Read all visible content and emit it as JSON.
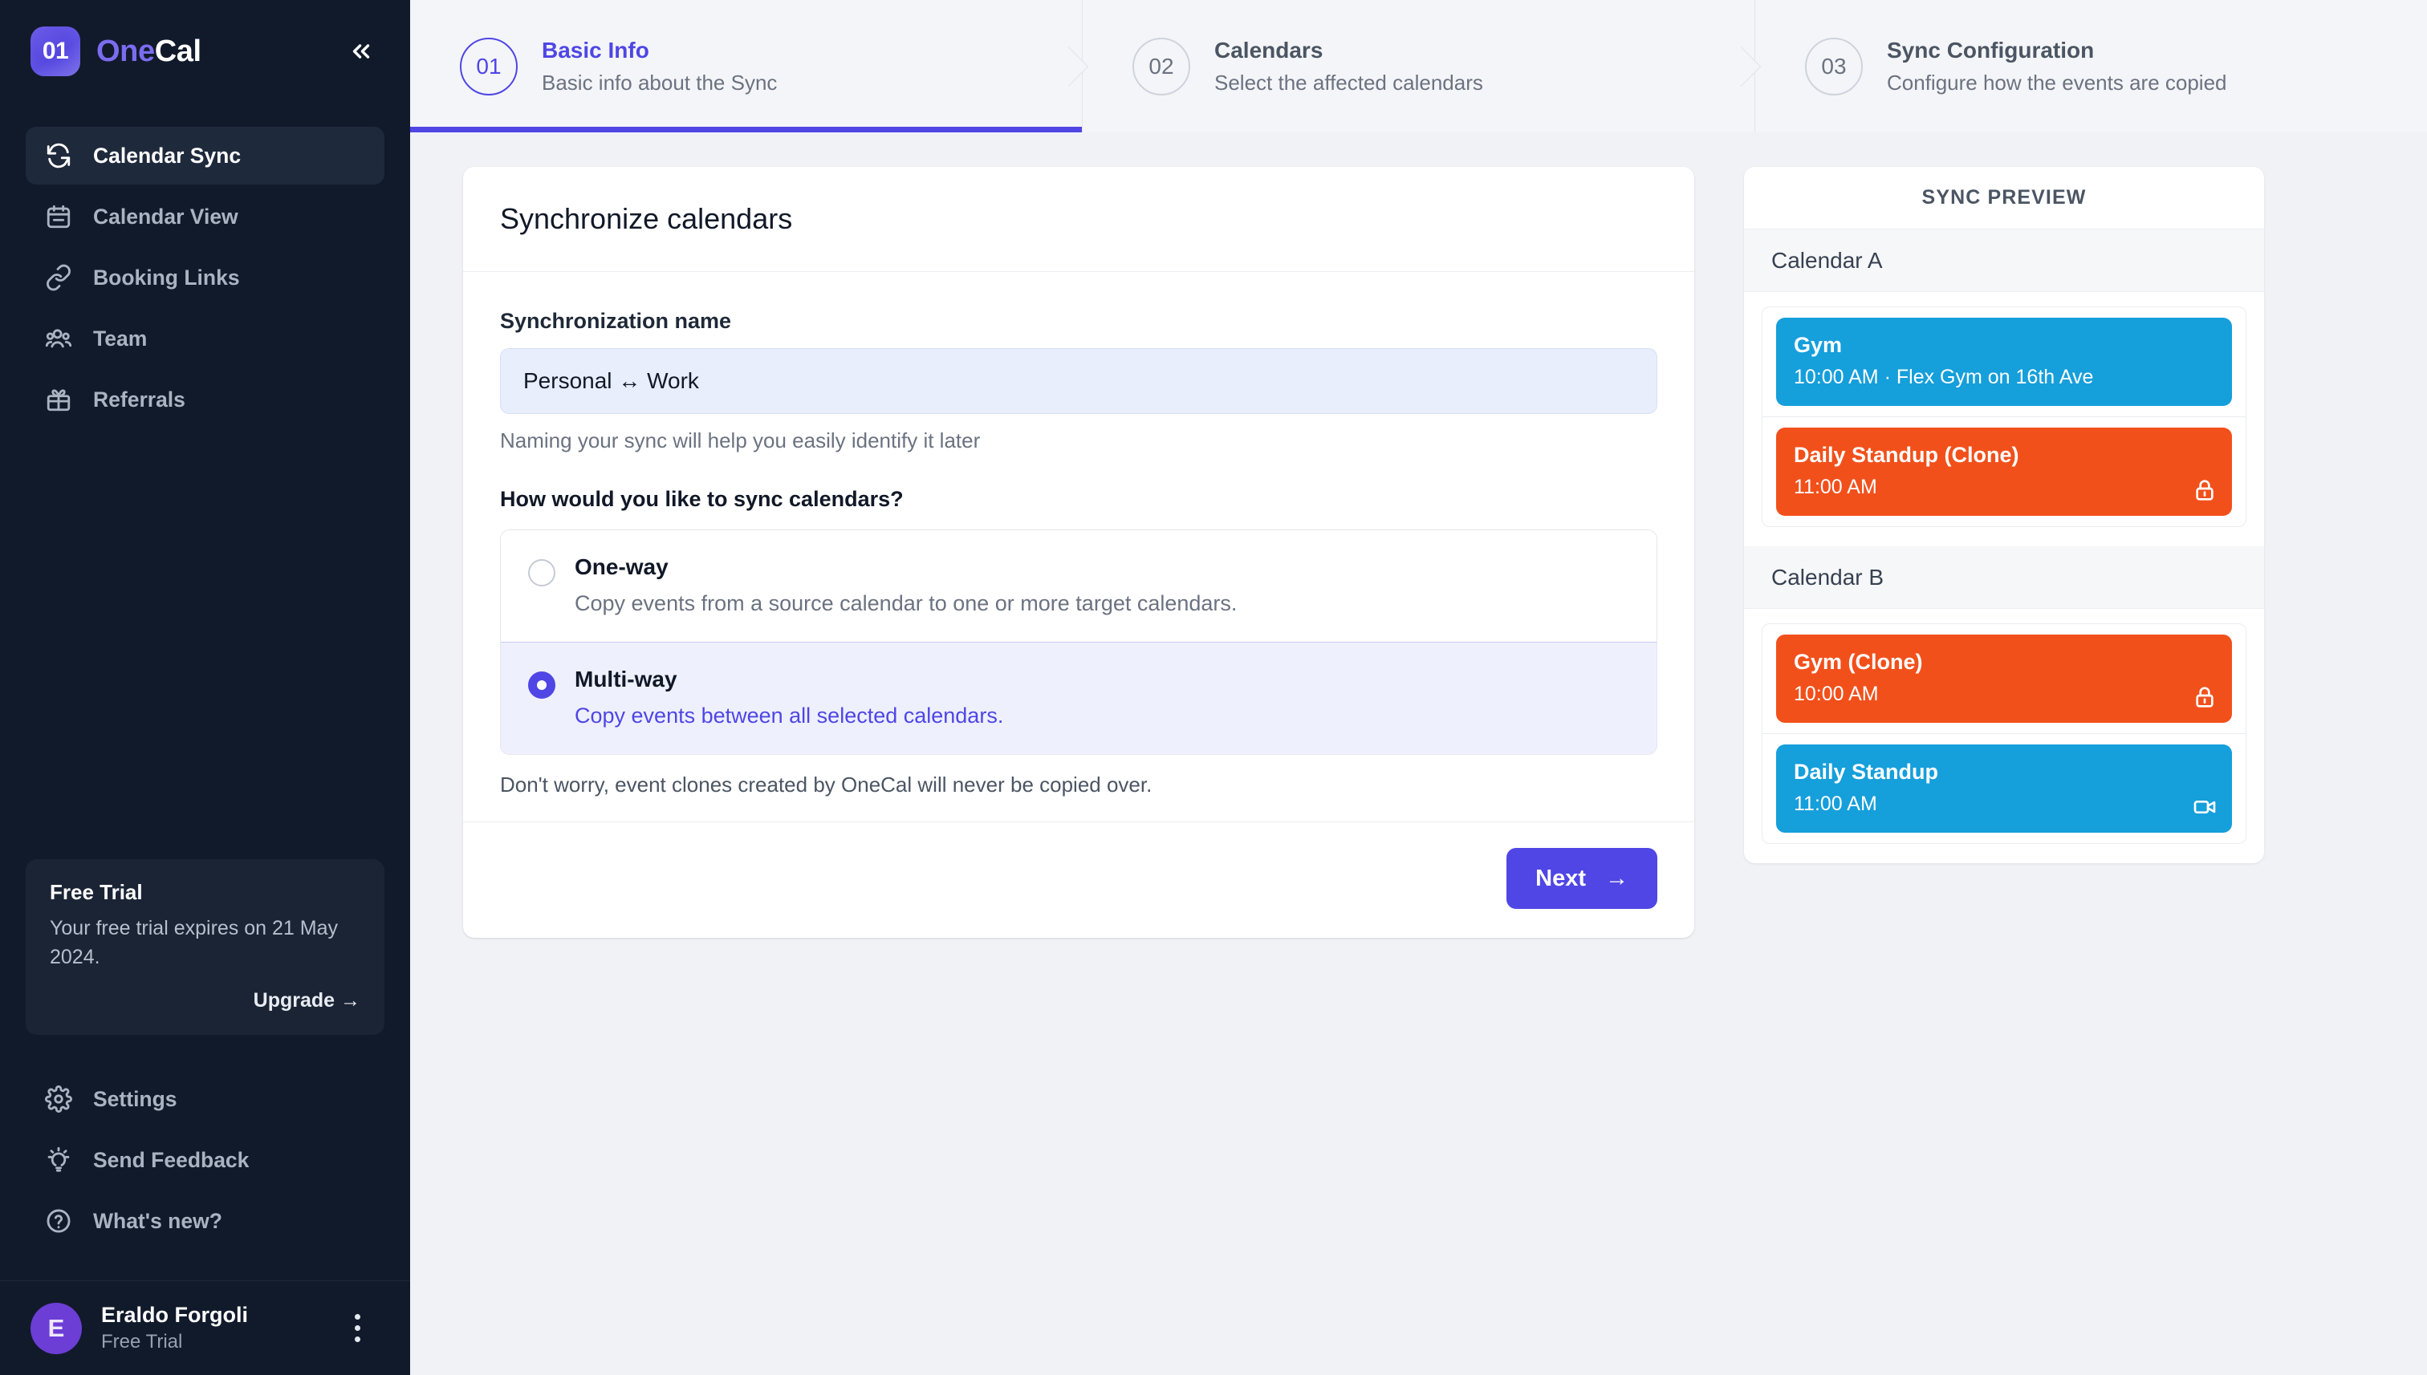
{
  "brand": {
    "logo_mark": "01",
    "name_first": "One",
    "name_second": "Cal",
    "collapse_icon": "chevrons-left-icon"
  },
  "sidebar": {
    "items": [
      {
        "label": "Calendar Sync",
        "icon": "sync-icon",
        "active": true
      },
      {
        "label": "Calendar View",
        "icon": "calendar-icon",
        "active": false
      },
      {
        "label": "Booking Links",
        "icon": "link-icon",
        "active": false
      },
      {
        "label": "Team",
        "icon": "users-icon",
        "active": false
      },
      {
        "label": "Referrals",
        "icon": "gift-icon",
        "active": false
      }
    ],
    "trial": {
      "title": "Free Trial",
      "text": "Your free trial expires on 21 May 2024.",
      "upgrade_label": "Upgrade →"
    },
    "bottom_items": [
      {
        "label": "Settings",
        "icon": "gear-icon"
      },
      {
        "label": "Send Feedback",
        "icon": "lightbulb-icon"
      },
      {
        "label": "What's new?",
        "icon": "question-circle-icon"
      }
    ],
    "user": {
      "initial": "E",
      "name": "Eraldo Forgoli",
      "plan": "Free Trial",
      "menu_icon": "more-vertical-icon"
    }
  },
  "stepper": {
    "steps": [
      {
        "num": "01",
        "title": "Basic Info",
        "subtitle": "Basic info about the Sync",
        "active": true
      },
      {
        "num": "02",
        "title": "Calendars",
        "subtitle": "Select the affected calendars",
        "active": false
      },
      {
        "num": "03",
        "title": "Sync Configuration",
        "subtitle": "Configure how the events are copied",
        "active": false
      }
    ]
  },
  "form": {
    "title": "Synchronize calendars",
    "name_label": "Synchronization name",
    "name_value": "Personal ↔ Work",
    "name_placeholder": "Synchronization name",
    "name_help": "Naming your sync will help you easily identify it later",
    "question": "How would you like to sync calendars?",
    "options": [
      {
        "title": "One-way",
        "description": "Copy events from a source calendar to one or more target calendars.",
        "selected": false
      },
      {
        "title": "Multi-way",
        "description": "Copy events between all selected calendars.",
        "selected": true
      }
    ],
    "note": "Don't worry, event clones created by OneCal will never be copied over.",
    "next_label": "Next",
    "next_arrow": "→"
  },
  "preview": {
    "title": "SYNC PREVIEW",
    "calendars": [
      {
        "name": "Calendar A",
        "events": [
          {
            "title": "Gym",
            "time": "10:00 AM",
            "detail": "Flex Gym on 16th Ave",
            "color": "blue",
            "badge": "none"
          },
          {
            "title": "Daily Standup (Clone)",
            "time": "11:00 AM",
            "detail": "",
            "color": "orange",
            "badge": "lock-icon"
          }
        ]
      },
      {
        "name": "Calendar B",
        "events": [
          {
            "title": "Gym (Clone)",
            "time": "10:00 AM",
            "detail": "",
            "color": "orange",
            "badge": "lock-icon"
          },
          {
            "title": "Daily Standup",
            "time": "11:00 AM",
            "detail": "",
            "color": "blue",
            "badge": "video-icon"
          }
        ]
      }
    ]
  },
  "colors": {
    "accent": "#4f46e5",
    "sidebar_bg": "#111a2b",
    "page_bg": "#f1f2f6",
    "event_blue": "#159fdb",
    "event_orange": "#f2501b",
    "avatar_bg": "#6c3ed6"
  }
}
